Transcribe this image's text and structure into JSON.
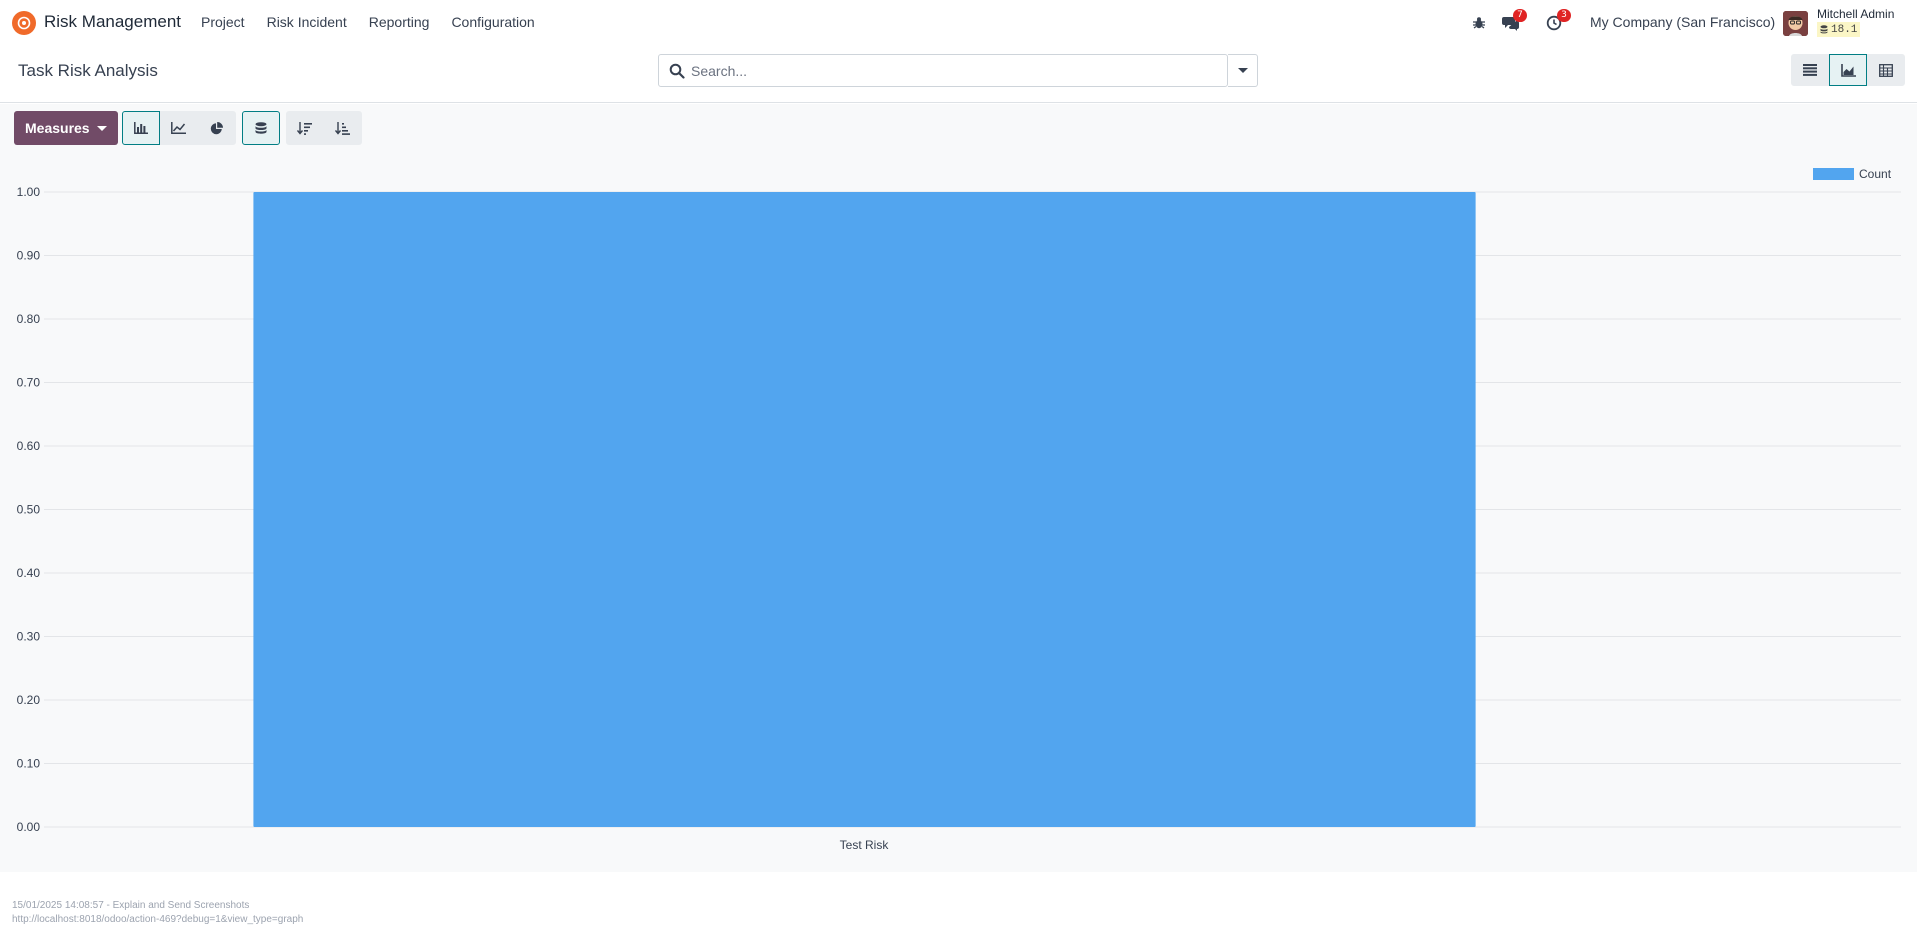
{
  "navbar": {
    "app_name": "Risk Management",
    "menu": [
      "Project",
      "Risk Incident",
      "Reporting",
      "Configuration"
    ],
    "messages_badge": "7",
    "activities_badge": "3",
    "company": "My Company (San Francisco)",
    "user_name": "Mitchell Admin",
    "version": "18.1"
  },
  "control_panel": {
    "title": "Task Risk Analysis",
    "search_placeholder": "Search..."
  },
  "toolbar": {
    "measures_label": "Measures"
  },
  "colors": {
    "brand": "#714b67",
    "accent": "#017e84",
    "bar": "#52a5ef",
    "logo": "#f06a2a"
  },
  "chart_data": {
    "type": "bar",
    "categories": [
      "Test Risk"
    ],
    "series": [
      {
        "name": "Count",
        "values": [
          1
        ]
      }
    ],
    "ylim": [
      0,
      1
    ],
    "yticks": [
      "0.00",
      "0.10",
      "0.20",
      "0.30",
      "0.40",
      "0.50",
      "0.60",
      "0.70",
      "0.80",
      "0.90",
      "1.00"
    ],
    "grid": true,
    "legend": "top-right"
  },
  "footer": {
    "line1": "15/01/2025 14:08:57 - Explain and Send Screenshots",
    "line2": "http://localhost:8018/odoo/action-469?debug=1&view_type=graph"
  }
}
